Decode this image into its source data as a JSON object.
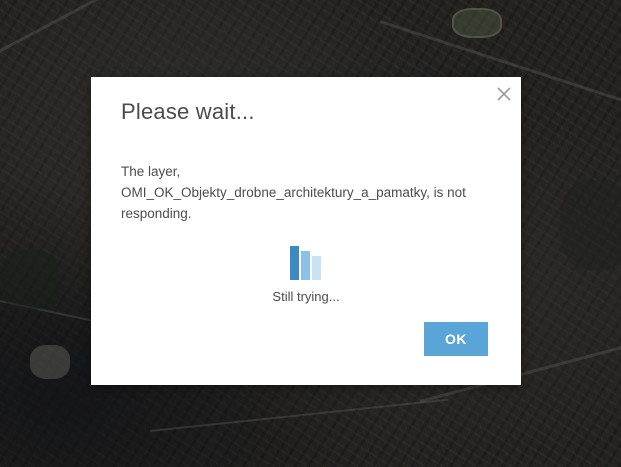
{
  "dialog": {
    "title": "Please wait...",
    "message_lines": [
      "The layer,",
      "OMI_OK_Objekty_drobne_architektury_a_pamatky, is not",
      "responding."
    ],
    "status": "Still trying...",
    "ok_label": "OK",
    "close_icon": "close-icon",
    "loader_icon": "loading-bars-icon"
  },
  "colors": {
    "accent": "#5aa5d8",
    "loader_dark": "#3b8ac4",
    "loader_mid": "#8dc0e6",
    "loader_light": "#c9e2f4",
    "text": "#4c4c4c",
    "map_background": "#2a2825"
  }
}
